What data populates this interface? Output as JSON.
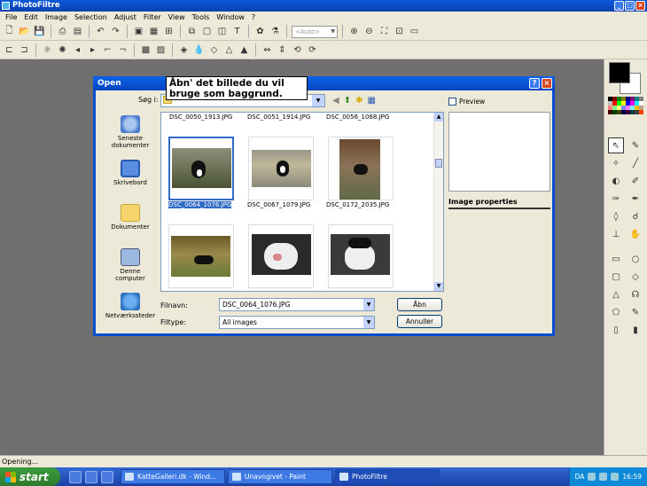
{
  "app": {
    "title": "PhotoFiltre",
    "menu": [
      "File",
      "Edit",
      "Image",
      "Selection",
      "Adjust",
      "Filter",
      "View",
      "Tools",
      "Window",
      "?"
    ],
    "zoom_placeholder": "<Auto>",
    "status": "Opening..."
  },
  "dialog": {
    "title": "Open",
    "tooltip": "Åbn' det billede du vil bruge som baggrund.",
    "look_in_label": "Søg i:",
    "places": [
      "Seneste dokumenter",
      "Skrivebord",
      "Dokumenter",
      "Denne computer",
      "Netværkssteder"
    ],
    "files_top_row": [
      "DSC_0050_1913.JPG",
      "DSC_0051_1914.JPG",
      "DSC_0056_1068.JPG"
    ],
    "files_mid_row": [
      "DSC_0064_1076.JPG",
      "DSC_0067_1079.JPG",
      "DSC_0172_2035.JPG"
    ],
    "filename_label": "Filnavn:",
    "filename_value": "DSC_0064_1076.JPG",
    "filetype_label": "Filtype:",
    "filetype_value": "All images",
    "open_button": "Åbn",
    "cancel_button": "Annuller",
    "preview_label": "Preview",
    "image_properties_label": "Image properties"
  },
  "taskbar": {
    "start_label": "start",
    "tasks": [
      "KatteGalleri.dk - Wind...",
      "Unavngivet - Paint",
      "PhotoFiltre"
    ],
    "language": "DA",
    "clock": "16:59"
  },
  "colors": {
    "titlebar": "#0a5ad8",
    "workspace": "#6f6f6f",
    "selection": "#316ac5"
  }
}
